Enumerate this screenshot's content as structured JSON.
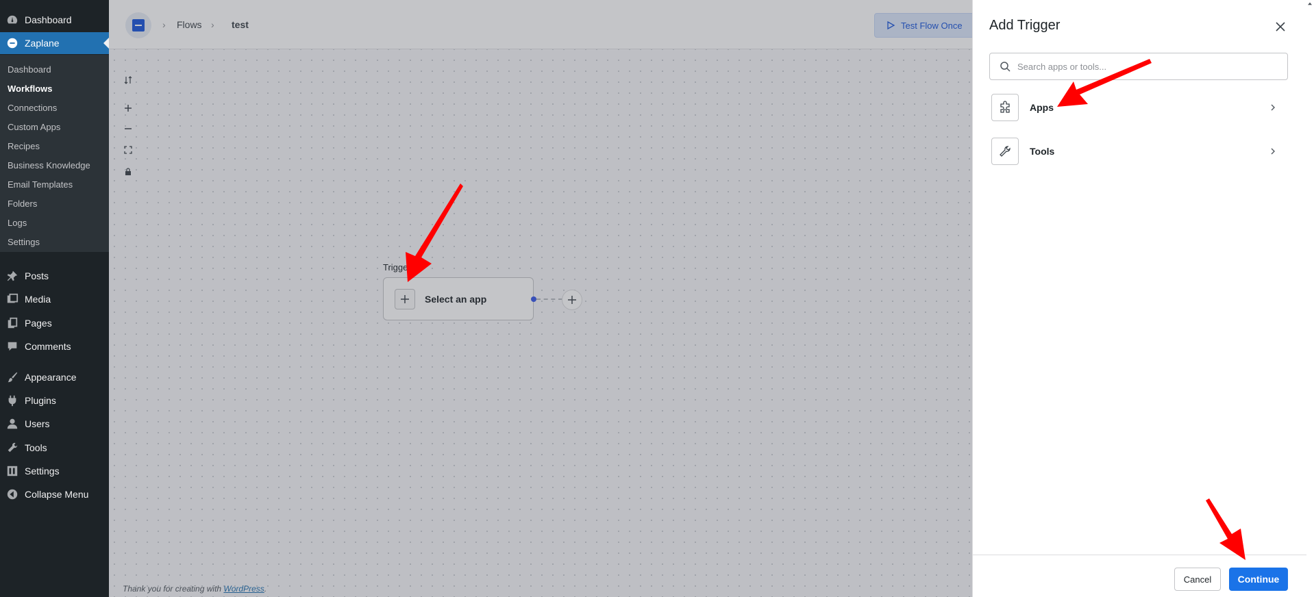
{
  "sidebar": {
    "top_items": [
      {
        "label": "Dashboard",
        "icon": "dashboard-icon"
      },
      {
        "label": "Zaplane",
        "icon": "zaplane-icon"
      }
    ],
    "submenu": [
      "Dashboard",
      "Workflows",
      "Connections",
      "Custom Apps",
      "Recipes",
      "Business Knowledge",
      "Email Templates",
      "Folders",
      "Logs",
      "Settings"
    ],
    "active_submenu": "Workflows",
    "bottom_items": [
      {
        "label": "Posts",
        "icon": "pin-icon"
      },
      {
        "label": "Media",
        "icon": "media-icon"
      },
      {
        "label": "Pages",
        "icon": "pages-icon"
      },
      {
        "label": "Comments",
        "icon": "comments-icon"
      },
      {
        "label": "Appearance",
        "icon": "appearance-icon"
      },
      {
        "label": "Plugins",
        "icon": "plugins-icon"
      },
      {
        "label": "Users",
        "icon": "users-icon"
      },
      {
        "label": "Tools",
        "icon": "tools-icon"
      },
      {
        "label": "Settings",
        "icon": "settings-icon"
      },
      {
        "label": "Collapse Menu",
        "icon": "collapse-icon"
      }
    ]
  },
  "header": {
    "breadcrumb": [
      "Flows",
      "test"
    ],
    "test_flow_label": "Test Flow Once"
  },
  "canvas": {
    "node_label": "Trigger",
    "node_text": "Select an app",
    "footer_prefix": "Thank you for creating with ",
    "footer_link": "WordPress",
    "footer_suffix": "."
  },
  "drawer": {
    "title": "Add Trigger",
    "search_placeholder": "Search apps or tools...",
    "options": [
      {
        "label": "Apps",
        "icon": "puzzle-icon"
      },
      {
        "label": "Tools",
        "icon": "wrench-icon"
      }
    ],
    "cancel_label": "Cancel",
    "continue_label": "Continue"
  },
  "colors": {
    "wp_sidebar": "#1d2327",
    "wp_accent": "#2271b1",
    "primary_button": "#1a73e8",
    "annotation_arrow": "#ff0000"
  }
}
